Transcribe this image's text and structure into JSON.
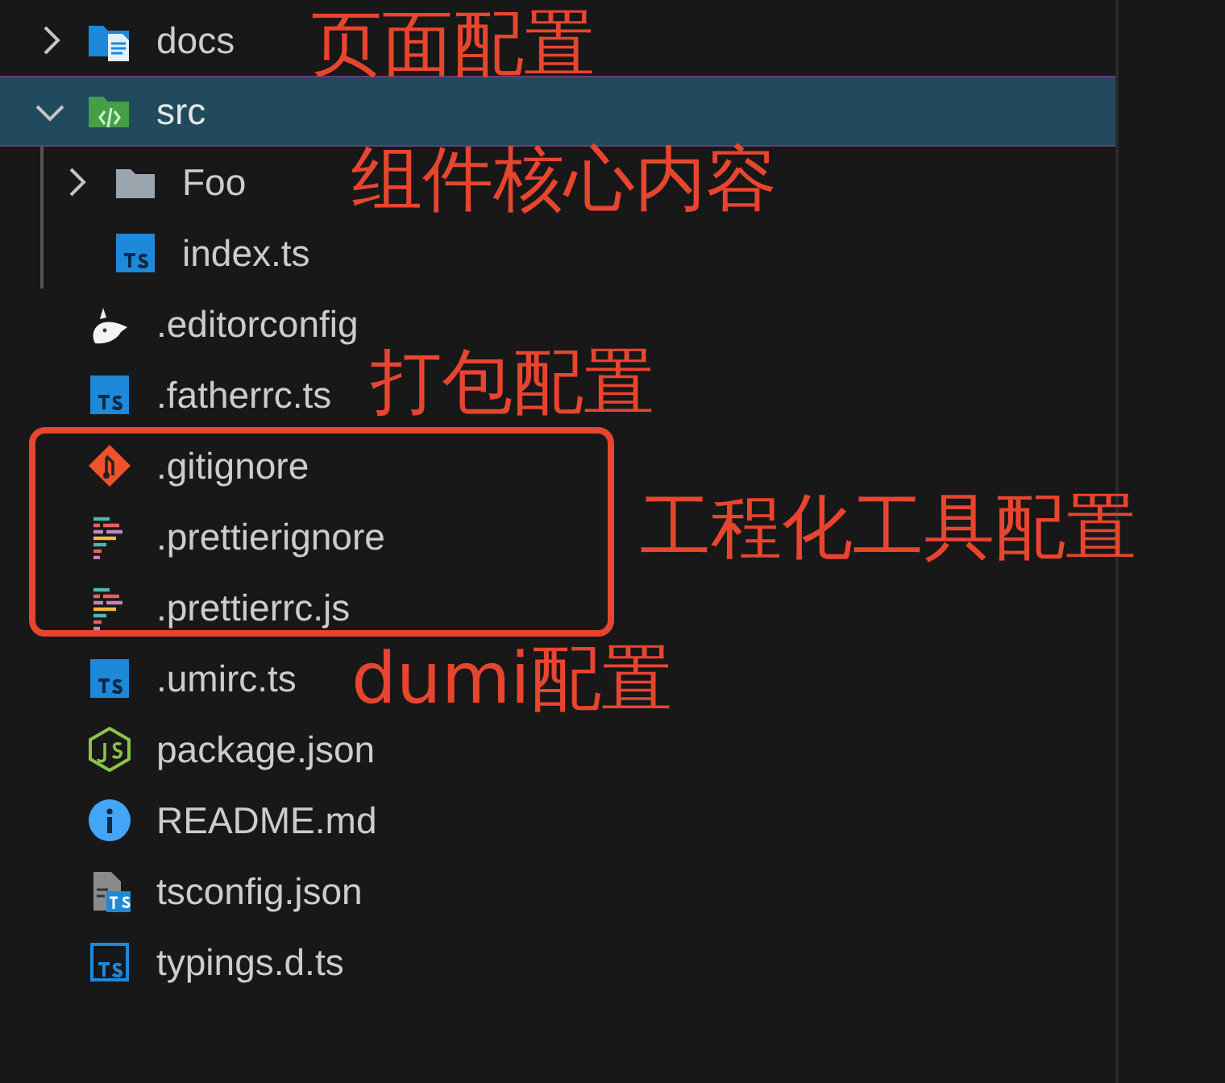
{
  "tree": [
    {
      "label": "docs",
      "kind": "docs",
      "expanded": false,
      "selected": false
    },
    {
      "label": "src",
      "kind": "srcfolder",
      "expanded": true,
      "selected": true,
      "children": [
        {
          "label": "Foo",
          "kind": "folder",
          "expanded": false,
          "selected": false
        },
        {
          "label": "index.ts",
          "kind": "ts",
          "selected": false
        }
      ]
    },
    {
      "label": ".editorconfig",
      "kind": "editorconfig",
      "selected": false
    },
    {
      "label": ".fatherrc.ts",
      "kind": "ts",
      "selected": false
    },
    {
      "label": ".gitignore",
      "kind": "git",
      "selected": false
    },
    {
      "label": ".prettierignore",
      "kind": "prettier",
      "selected": false
    },
    {
      "label": ".prettierrc.js",
      "kind": "prettier",
      "selected": false
    },
    {
      "label": ".umirc.ts",
      "kind": "ts",
      "selected": false
    },
    {
      "label": "package.json",
      "kind": "nodejs",
      "selected": false
    },
    {
      "label": "README.md",
      "kind": "info",
      "selected": false
    },
    {
      "label": "tsconfig.json",
      "kind": "tsconfig",
      "selected": false
    },
    {
      "label": "typings.d.ts",
      "kind": "dts",
      "selected": false
    }
  ],
  "annotations": [
    "页面配置",
    "组件核心内容",
    "打包配置",
    "工程化工具配置",
    "dumi配置"
  ]
}
